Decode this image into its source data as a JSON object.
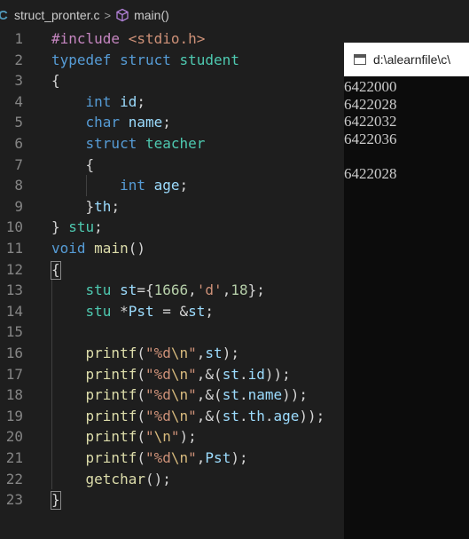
{
  "breadcrumb": {
    "lang_icon": "C",
    "file": "struct_pronter.c",
    "separator": ">",
    "symbol": "main()"
  },
  "editor": {
    "line_numbers": [
      "1",
      "2",
      "3",
      "4",
      "5",
      "6",
      "7",
      "8",
      "9",
      "10",
      "11",
      "12",
      "13",
      "14",
      "15",
      "16",
      "17",
      "18",
      "19",
      "20",
      "21",
      "22",
      "23"
    ],
    "code_lines": [
      "#include <stdio.h>",
      "typedef struct student",
      "{",
      "    int id;",
      "    char name;",
      "    struct teacher",
      "    {",
      "        int age;",
      "    }th;",
      "} stu;",
      "void main()",
      "{",
      "    stu st={1666,'d',18};",
      "    stu *Pst = &st;",
      "",
      "    printf(\"%d\\n\",st);",
      "    printf(\"%d\\n\",&(st.id));",
      "    printf(\"%d\\n\",&(st.name));",
      "    printf(\"%d\\n\",&(st.th.age));",
      "    printf(\"\\n\");",
      "    printf(\"%d\\n\",Pst);",
      "    getchar();",
      "}"
    ]
  },
  "console": {
    "title": "d:\\alearnfile\\c\\",
    "output": [
      "6422000",
      "6422028",
      "6422032",
      "6422036",
      "",
      "6422028"
    ]
  },
  "colors": {
    "editor_bg": "#1e1e1e",
    "keyword": "#569cd6",
    "type": "#4ec9b0",
    "variable": "#9cdcfe",
    "function": "#dcdcaa",
    "number": "#b5cea8",
    "string": "#ce9178",
    "console_bg": "#0c0c0c"
  },
  "icons": [
    "c-file-icon",
    "cube-symbol-icon",
    "console-window-icon"
  ]
}
